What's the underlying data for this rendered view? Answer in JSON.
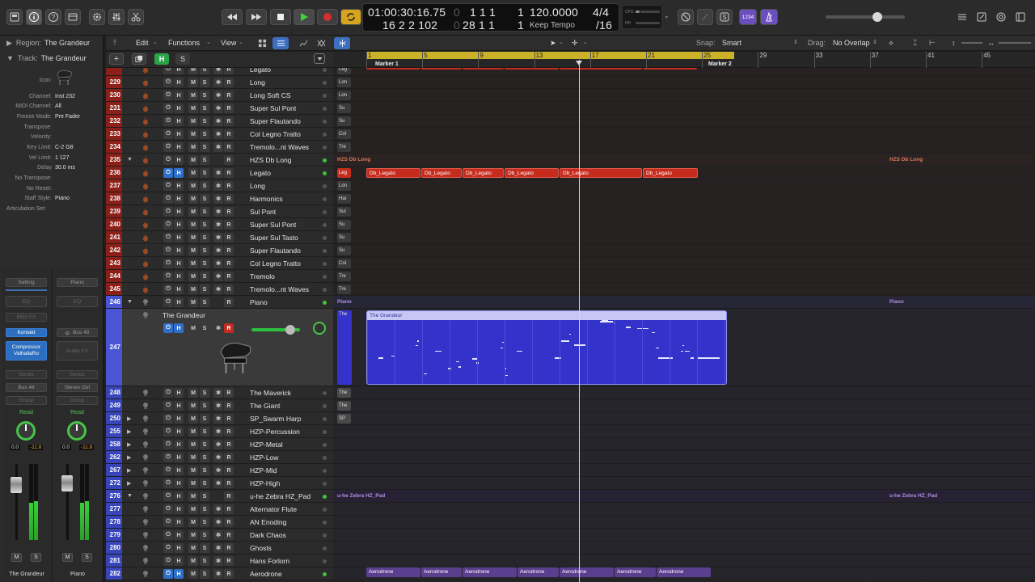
{
  "colors": {
    "accent_blue": "#2f6fc8",
    "region_red": "#c62c1e",
    "region_blue": "#3333cc",
    "region_purple": "#5a3f8f",
    "cycle_yellow": "#c9b227",
    "green": "#3ec43e"
  },
  "transport": {
    "time": "01:00:30:16.75",
    "bars_top": "1   1   1",
    "bars_top_right": "1",
    "position": "16  2  2  102",
    "position_end": "28  1  1",
    "position_end_right": "1",
    "tempo": "120.0000",
    "tempo_mode": "Keep Tempo",
    "signature": "4/4",
    "division": "/16",
    "cpu_label": "CPU",
    "hd_label": "HD",
    "count_in": "1234"
  },
  "inspector": {
    "region_label": "Region:",
    "region_name": "The Grandeur",
    "track_label": "Track:",
    "track_name": "The Grandeur",
    "rows": [
      {
        "label": "Icon:",
        "value": ""
      },
      {
        "label": "Channel:",
        "value": "Inst 232"
      },
      {
        "label": "MIDI Channel:",
        "value": "All"
      },
      {
        "label": "Freeze Mode:",
        "value": "Pre Fader"
      },
      {
        "label": "Transpose:",
        "value": ""
      },
      {
        "label": "Velocity:",
        "value": ""
      },
      {
        "label": "Key Limit:",
        "value": "C-2  G8"
      },
      {
        "label": "Vel Limit:",
        "value": "1  127"
      },
      {
        "label": "Delay",
        "value": "30.0 ms"
      },
      {
        "label": "No Transpose:",
        "value": ""
      },
      {
        "label": "No Reset:",
        "value": ""
      },
      {
        "label": "Staff Style:",
        "value": "Piano"
      },
      {
        "label": "Articulation Set:",
        "value": ""
      }
    ],
    "strip1": {
      "setting": "Setting",
      "eq": "EQ",
      "midi_fx": "MIDI FX",
      "plugin1": "Kontakt",
      "plugin2a": "Compressor",
      "plugin2b": "ValhallaRo",
      "sends": "Sends",
      "output": "Bus 48",
      "group": "Group",
      "auto": "Read",
      "pan_db": "0.0",
      "peak_db": "-11.8",
      "name": "The Grandeur",
      "mute": "M",
      "solo": "S"
    },
    "strip2": {
      "setting": "Piano",
      "eq": "EQ",
      "input": "Bus 48",
      "audio_fx": "Audio FX",
      "sends": "Sends",
      "output": "Stereo Out",
      "group": "Group",
      "auto": "Read",
      "pan_db": "0.0",
      "peak_db": "-11.8",
      "name": "Piano",
      "mute": "M",
      "solo": "S"
    }
  },
  "menubar": {
    "edit": "Edit",
    "functions": "Functions",
    "view": "View",
    "snap_label": "Snap:",
    "snap_value": "Smart",
    "drag_label": "Drag:",
    "drag_value": "No Overlap"
  },
  "track_header": {
    "add": "+",
    "h": "H",
    "s": "S"
  },
  "track_buttons": {
    "h": "H",
    "m": "M",
    "s": "S",
    "r": "R",
    "freeze": "✻"
  },
  "tracks": [
    {
      "num": "",
      "name": "Legato",
      "color": "red"
    },
    {
      "num": "229",
      "name": "Long",
      "color": "red"
    },
    {
      "num": "230",
      "name": "Long Soft CS",
      "color": "red"
    },
    {
      "num": "231",
      "name": "Super Sul Pont",
      "color": "red"
    },
    {
      "num": "232",
      "name": "Super Flautando",
      "color": "red"
    },
    {
      "num": "233",
      "name": "Col Legno Tratto",
      "color": "red"
    },
    {
      "num": "234",
      "name": "Tremolo...nt Waves",
      "color": "red"
    },
    {
      "num": "235",
      "name": "HZS Db Long",
      "color": "red"
    },
    {
      "num": "236",
      "name": "Legato",
      "color": "red"
    },
    {
      "num": "237",
      "name": "Long",
      "color": "red"
    },
    {
      "num": "238",
      "name": "Harmonics",
      "color": "red"
    },
    {
      "num": "239",
      "name": "Sul Pont",
      "color": "red"
    },
    {
      "num": "240",
      "name": "Super Sul Pont",
      "color": "red"
    },
    {
      "num": "241",
      "name": "Super Sul Tasto",
      "color": "red"
    },
    {
      "num": "242",
      "name": "Super Flautando",
      "color": "red"
    },
    {
      "num": "243",
      "name": "Col Legno Tratto",
      "color": "red"
    },
    {
      "num": "244",
      "name": "Tremolo",
      "color": "red"
    },
    {
      "num": "245",
      "name": "Tremolo...nt Waves",
      "color": "red"
    },
    {
      "num": "246",
      "name": "Piano",
      "color": "blue"
    },
    {
      "num": "247",
      "name": "The Grandeur",
      "color": "blue"
    },
    {
      "num": "248",
      "name": "The Maverick",
      "color": "blue"
    },
    {
      "num": "249",
      "name": "The Giant",
      "color": "blue"
    },
    {
      "num": "250",
      "name": "SP_Swarm Harp",
      "color": "blue"
    },
    {
      "num": "255",
      "name": "HZP-Percussion",
      "color": "blue"
    },
    {
      "num": "258",
      "name": "HZP-Metal",
      "color": "blue"
    },
    {
      "num": "262",
      "name": "HZP-Low",
      "color": "blue"
    },
    {
      "num": "267",
      "name": "HZP-Mid",
      "color": "blue"
    },
    {
      "num": "272",
      "name": "HZP-High",
      "color": "blue"
    },
    {
      "num": "276",
      "name": "u-he Zebra HZ_Pad",
      "color": "blue"
    },
    {
      "num": "277",
      "name": "Alternator Flute",
      "color": "blue"
    },
    {
      "num": "278",
      "name": "AN Enoding",
      "color": "blue"
    },
    {
      "num": "279",
      "name": "Dark Chaos",
      "color": "blue"
    },
    {
      "num": "280",
      "name": "Ghosts",
      "color": "blue"
    },
    {
      "num": "281",
      "name": "Hans Forlorn",
      "color": "blue"
    },
    {
      "num": "282",
      "name": "Aerodrone",
      "color": "blue"
    }
  ],
  "ruler": {
    "bars": [
      "1",
      "5",
      "9",
      "13",
      "17",
      "21",
      "25",
      "29",
      "33",
      "37",
      "41",
      "45"
    ],
    "markers": [
      "Marker 1",
      "Marker 2"
    ]
  },
  "regions": {
    "hzs_folder": "HZS Db Long",
    "db_legato": "Db_Legato",
    "piano_folder": "Piano",
    "grandeur": "The Grandeur",
    "zebra_folder": "u-he Zebra HZ_Pad",
    "aerodrone": "Aerodrone",
    "mini": {
      "long": "Lon",
      "su": "Su",
      "col": "Col",
      "tre": "Tre",
      "leg": "Leg",
      "har": "Har",
      "sul": "Sul",
      "the": "The",
      "sp": "SP"
    }
  }
}
